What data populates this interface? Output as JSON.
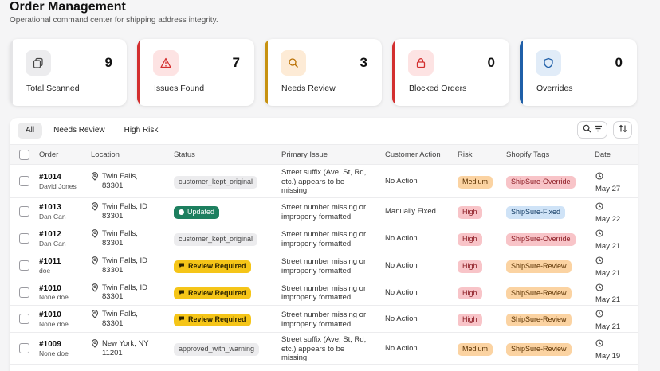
{
  "header": {
    "title": "Order Management",
    "subtitle": "Operational command center for shipping address integrity."
  },
  "stats": [
    {
      "label": "Total Scanned",
      "value": "9",
      "icon": "copy-icon",
      "accent": "#e5e5e7"
    },
    {
      "label": "Issues Found",
      "value": "7",
      "icon": "alert-triangle-icon",
      "accent": "#d32f2f"
    },
    {
      "label": "Needs Review",
      "value": "3",
      "icon": "search-icon",
      "accent": "#c79211"
    },
    {
      "label": "Blocked Orders",
      "value": "0",
      "icon": "lock-icon",
      "accent": "#d32f2f"
    },
    {
      "label": "Overrides",
      "value": "0",
      "icon": "shield-icon",
      "accent": "#1f5fa8"
    }
  ],
  "tabs": [
    "All",
    "Needs Review",
    "High Risk"
  ],
  "columns": [
    "Order",
    "Location",
    "Status",
    "Primary Issue",
    "Customer Action",
    "Risk",
    "Shopify Tags",
    "Date"
  ],
  "rows": [
    {
      "order": "#1014",
      "customer": "David Jones",
      "loc1": "Twin Falls,",
      "loc2": "83301",
      "status": "customer_kept_original",
      "status_type": "gray",
      "issue1": "Street suffix (Ave, St, Rd,",
      "issue2": "etc.) appears to be",
      "issue3": "missing.",
      "action": "No Action",
      "risk": "Medium",
      "tag": "ShipSure-Override",
      "date": "May 27"
    },
    {
      "order": "#1013",
      "customer": "Dan Can",
      "loc1": "Twin Falls, ID",
      "loc2": "83301",
      "status": "Updated",
      "status_type": "green",
      "issue1": "Street number missing or",
      "issue2": "improperly formatted.",
      "issue3": "",
      "action": "Manually Fixed",
      "risk": "High",
      "tag": "ShipSure-Fixed",
      "date": "May 22"
    },
    {
      "order": "#1012",
      "customer": "Dan Can",
      "loc1": "Twin Falls,",
      "loc2": "83301",
      "status": "customer_kept_original",
      "status_type": "gray",
      "issue1": "Street number missing or",
      "issue2": "improperly formatted.",
      "issue3": "",
      "action": "No Action",
      "risk": "High",
      "tag": "ShipSure-Override",
      "date": "May 21"
    },
    {
      "order": "#1011",
      "customer": "doe",
      "loc1": "Twin Falls, ID",
      "loc2": "83301",
      "status": "Review Required",
      "status_type": "yellow",
      "issue1": "Street number missing or",
      "issue2": "improperly formatted.",
      "issue3": "",
      "action": "No Action",
      "risk": "High",
      "tag": "ShipSure-Review",
      "date": "May 21"
    },
    {
      "order": "#1010",
      "customer": "None doe",
      "loc1": "Twin Falls, ID",
      "loc2": "83301",
      "status": "Review Required",
      "status_type": "yellow",
      "issue1": "Street number missing or",
      "issue2": "improperly formatted.",
      "issue3": "",
      "action": "No Action",
      "risk": "High",
      "tag": "ShipSure-Review",
      "date": "May 21"
    },
    {
      "order": "#1010",
      "customer": "None doe",
      "loc1": "Twin Falls,",
      "loc2": "83301",
      "status": "Review Required",
      "status_type": "yellow",
      "issue1": "Street number missing or",
      "issue2": "improperly formatted.",
      "issue3": "",
      "action": "No Action",
      "risk": "High",
      "tag": "ShipSure-Review",
      "date": "May 21"
    },
    {
      "order": "#1009",
      "customer": "None doe",
      "loc1": "New York, NY",
      "loc2": "11201",
      "status": "approved_with_warning",
      "status_type": "gray",
      "issue1": "Street suffix (Ave, St, Rd,",
      "issue2": "etc.) appears to be",
      "issue3": "missing.",
      "action": "No Action",
      "risk": "Medium",
      "tag": "ShipSure-Review",
      "date": "May 19"
    }
  ]
}
